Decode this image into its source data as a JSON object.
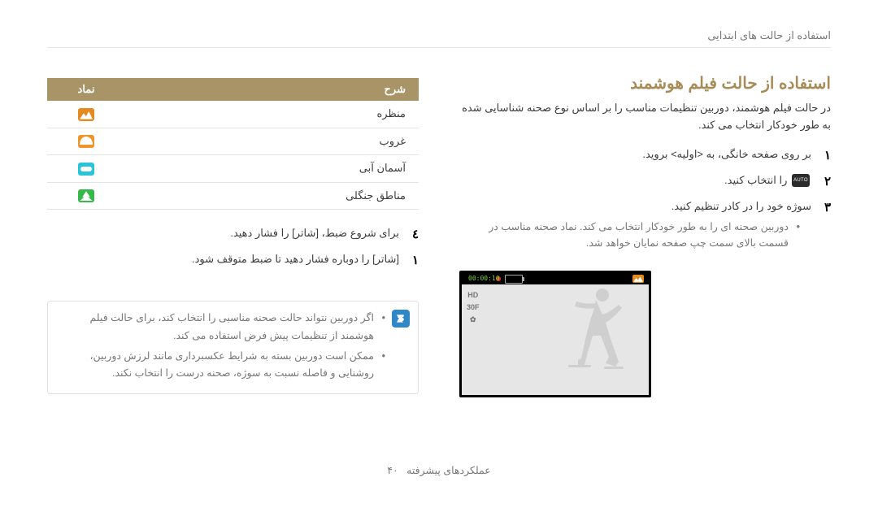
{
  "breadcrumb": "استفاده از حالت های ابتدایی",
  "section_title": "استفاده از حالت فیلم هوشمند",
  "lead": "در حالت فیلم هوشمند، دوربین تنظیمات مناسب را بر اساس نوع صحنه شناسایی شده به طور خودکار انتخاب می کند.",
  "steps": {
    "1": "بر روی صفحه خانگی، به <اولیه> بروید.",
    "2_before": "",
    "2_after": " را انتخاب کنید.",
    "3": "سوژه خود را در کادر تنظیم کنید.",
    "3_sub": "دوربین صحنه ای را به طور خودکار انتخاب می کند. نماد صحنه مناسب در قسمت بالای سمت چپ صفحه نمایان خواهد شد.",
    "4": "برای شروع ضبط، [شاتر] را فشار دهید.",
    "5": "[شاتر] را دوباره فشار دهید تا ضبط متوقف شود."
  },
  "lcd": {
    "timecode": "00:00:10",
    "hd": "HD",
    "ic2": "30F",
    "ic3": "✿"
  },
  "table": {
    "head_desc": "شرح",
    "head_icon": "نماد",
    "rows": [
      {
        "desc": "منظره",
        "icon": "landscape",
        "icon_name": "landscape-icon",
        "color": "orange"
      },
      {
        "desc": "غروب",
        "icon": "sunset",
        "icon_name": "sunset-icon",
        "color": "orange2"
      },
      {
        "desc": "آسمان آبی",
        "icon": "sky",
        "icon_name": "blue-sky-icon",
        "color": "cyan"
      },
      {
        "desc": "مناطق جنگلی",
        "icon": "forest",
        "icon_name": "forest-icon",
        "color": "green"
      }
    ]
  },
  "note": {
    "1": "اگر دوربین نتواند حالت صحنه مناسبی را انتخاب کند، برای حالت فیلم هوشمند از تنظیمات پیش فرض استفاده می کند.",
    "2": "ممکن است دوربین بسته به شرایط عکسبرداری مانند لرزش دوربین، روشنایی و فاصله نسبت به سوژه، صحنه درست را انتخاب نکند."
  },
  "footer": {
    "label": "عملکردهای پیشرفته",
    "page": "۴۰"
  }
}
